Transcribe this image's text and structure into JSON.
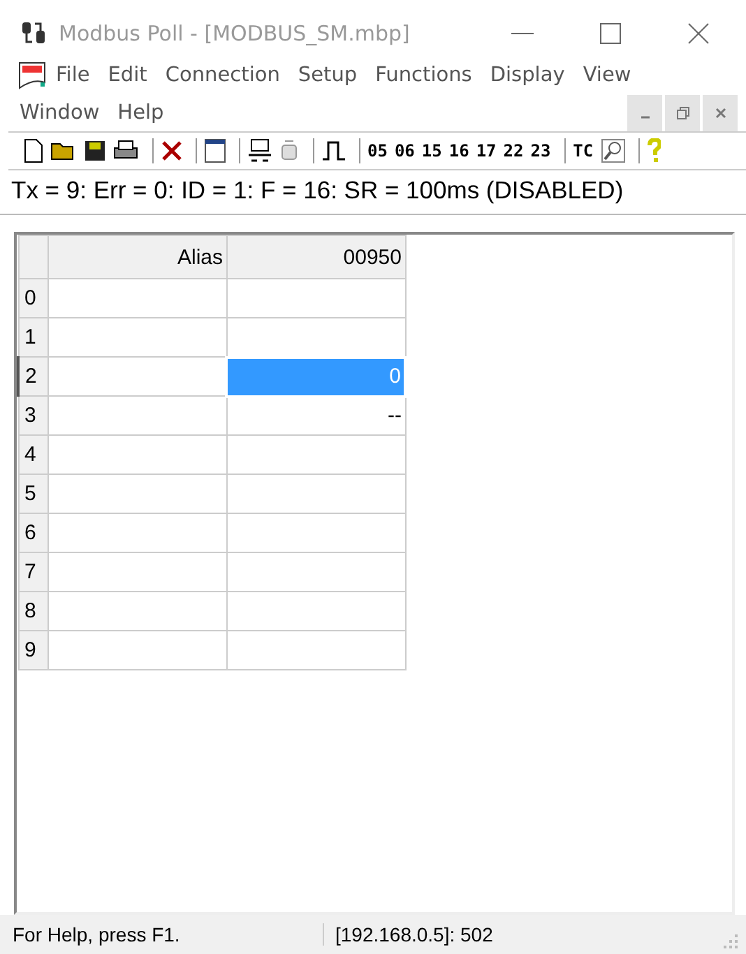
{
  "window": {
    "title": "Modbus Poll - [MODBUS_SM.mbp]"
  },
  "menu": [
    "File",
    "Edit",
    "Connection",
    "Setup",
    "Functions",
    "Display",
    "View",
    "Window",
    "Help"
  ],
  "toolbar": {
    "function_codes": [
      "05",
      "06",
      "15",
      "16",
      "17",
      "22",
      "23"
    ],
    "tc": "TC"
  },
  "status_line": "Tx = 9: Err = 0: ID = 1: F = 16: SR = 100ms  (DISABLED)",
  "table": {
    "columns": [
      "Alias",
      "00950"
    ],
    "rows": [
      {
        "label": "0",
        "selected": false
      },
      {
        "label": "1",
        "selected": false
      },
      {
        "label": "2",
        "value": "0",
        "selected": true
      },
      {
        "label": "3",
        "value": "--",
        "selected": false
      },
      {
        "label": "4",
        "selected": false
      },
      {
        "label": "5",
        "selected": false
      },
      {
        "label": "6",
        "selected": false
      },
      {
        "label": "7",
        "selected": false
      },
      {
        "label": "8",
        "selected": false
      },
      {
        "label": "9",
        "selected": false
      }
    ]
  },
  "status_bar": [
    "For Help, press F1.",
    "[192.168.0.5]: 502"
  ]
}
